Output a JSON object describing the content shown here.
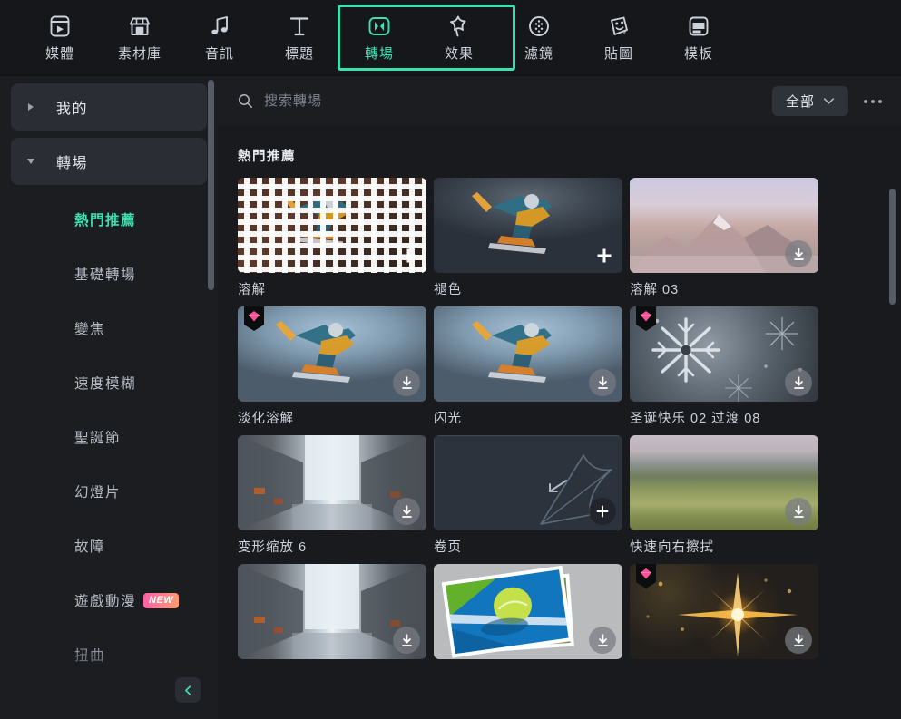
{
  "toolbar": {
    "tabs": [
      {
        "label": "媒體",
        "icon": "media-icon",
        "active": false
      },
      {
        "label": "素材庫",
        "icon": "store-icon",
        "active": false
      },
      {
        "label": "音訊",
        "icon": "music-note-icon",
        "active": false
      },
      {
        "label": "標題",
        "icon": "text-t-icon",
        "active": false
      },
      {
        "label": "轉場",
        "icon": "transition-icon",
        "active": true
      },
      {
        "label": "效果",
        "icon": "sparkle-star-icon",
        "active": false
      },
      {
        "label": "濾鏡",
        "icon": "filter-circle-icon",
        "active": false
      },
      {
        "label": "貼圖",
        "icon": "sticker-face-icon",
        "active": false
      },
      {
        "label": "模板",
        "icon": "template-icon",
        "active": false
      }
    ],
    "highlight_color": "#3fe0b0"
  },
  "sidebar": {
    "groups": [
      {
        "label": "我的",
        "expanded": false,
        "caret": "caret-right"
      },
      {
        "label": "轉場",
        "expanded": true,
        "caret": "caret-down"
      }
    ],
    "items": [
      {
        "label": "熱門推薦",
        "active": true,
        "badge": null
      },
      {
        "label": "基礎轉場",
        "active": false,
        "badge": null
      },
      {
        "label": "變焦",
        "active": false,
        "badge": null
      },
      {
        "label": "速度模糊",
        "active": false,
        "badge": null
      },
      {
        "label": "聖誕節",
        "active": false,
        "badge": null
      },
      {
        "label": "幻燈片",
        "active": false,
        "badge": null
      },
      {
        "label": "故障",
        "active": false,
        "badge": null
      },
      {
        "label": "遊戲動漫",
        "active": false,
        "badge": "NEW"
      },
      {
        "label": "扭曲",
        "active": false,
        "badge": null
      }
    ],
    "collapse_icon": "chevron-left-icon",
    "active_color": "#3fe0b0"
  },
  "search": {
    "icon": "search-icon",
    "placeholder": "搜索轉場",
    "value": ""
  },
  "filter": {
    "label": "全部",
    "caret_icon": "chevron-down-icon",
    "more_icon": "ellipsis-icon"
  },
  "main": {
    "section_title": "熱門推薦",
    "cards": [
      {
        "label": "溶解",
        "art": "art-snow1",
        "overlay": "squares",
        "action": "plus-plain",
        "pro": false
      },
      {
        "label": "褪色",
        "art": "art-snow1",
        "overlay": "rider",
        "action": "plus-plain",
        "pro": false
      },
      {
        "label": "溶解 03",
        "art": "art-mountain",
        "overlay": "peak",
        "action": "download",
        "pro": false
      },
      {
        "label": "淡化溶解",
        "art": "art-snow2",
        "overlay": "rider",
        "action": "download",
        "pro": true
      },
      {
        "label": "闪光",
        "art": "art-snow2",
        "overlay": "rider",
        "action": "download",
        "pro": false
      },
      {
        "label": "圣诞快乐 02 过渡 08",
        "art": "art-snowflake",
        "overlay": "flake",
        "action": "download",
        "pro": true
      },
      {
        "label": "变形缩放 6",
        "art": "art-city",
        "overlay": "zoom",
        "action": "download",
        "pro": false
      },
      {
        "label": "卷页",
        "art": "art-curl",
        "overlay": "curl",
        "action": "plus-circ",
        "pro": false
      },
      {
        "label": "快速向右擦拭",
        "art": "art-field",
        "overlay": "none",
        "action": "download",
        "pro": false
      },
      {
        "label": "",
        "art": "art-city",
        "overlay": "zoom",
        "action": "download",
        "pro": false
      },
      {
        "label": "",
        "art": "art-tennis",
        "overlay": "photos",
        "action": "download",
        "pro": false
      },
      {
        "label": "",
        "art": "art-sparkle",
        "overlay": "star",
        "action": "download",
        "pro": true
      }
    ]
  }
}
